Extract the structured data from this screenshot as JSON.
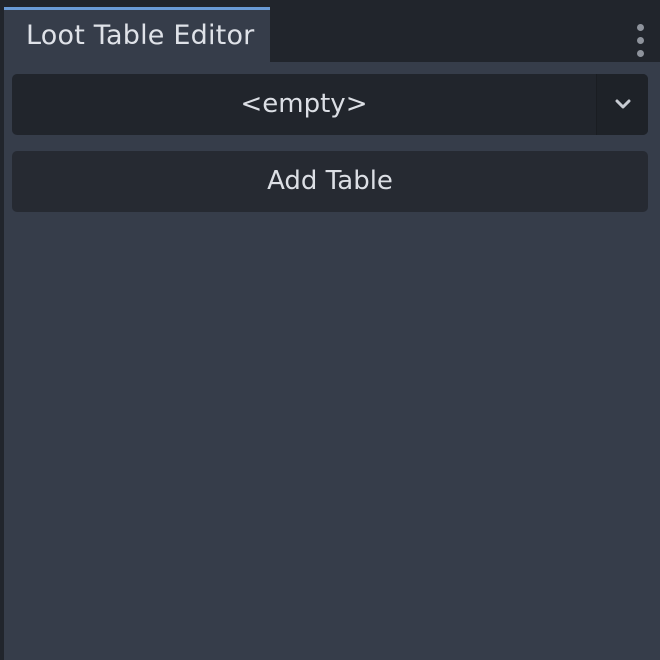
{
  "tab": {
    "label": "Loot Table Editor"
  },
  "table_select": {
    "selected": "<empty>"
  },
  "actions": {
    "add_table_label": "Add Table"
  },
  "icons": {
    "menu": "kebab-vertical-icon",
    "dropdown_arrow": "chevron-down-icon"
  },
  "colors": {
    "accent": "#6a9bd6",
    "panel": "#363d4a",
    "field": "#21252c",
    "text": "#dcdfe5"
  }
}
